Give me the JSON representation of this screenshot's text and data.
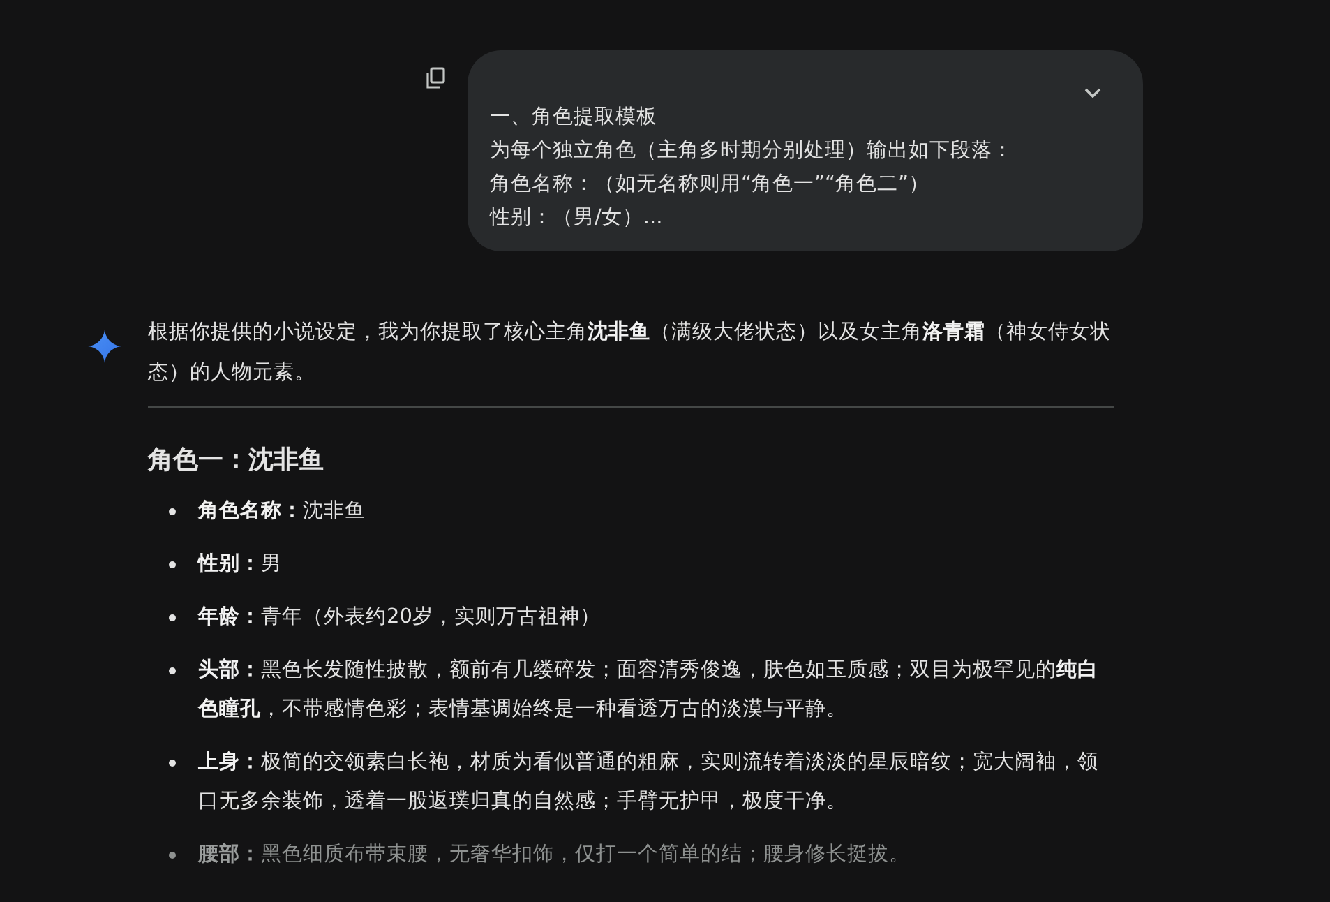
{
  "user_message": {
    "lines": [
      "一、角色提取模板",
      "为每个独立角色（主角多时期分别处理）输出如下段落：",
      "角色名称：（如无名称则用“角色一”“角色二”）",
      "性别：（男/女）..."
    ],
    "expanded": false
  },
  "response": {
    "intro": "根据你提供的小说设定，我为你提取了核心主角**沈非鱼**（满级大佬状态）以及女主角**洛青霜**（神女侍女状态）的人物元素。",
    "heading": "角色一：沈非鱼",
    "items": [
      {
        "label": "角色名称：",
        "text": "沈非鱼",
        "dimmed": false
      },
      {
        "label": "性别：",
        "text": "男",
        "dimmed": false
      },
      {
        "label": "年龄：",
        "text": "青年（外表约20岁，实则万古祖神）",
        "dimmed": false
      },
      {
        "label": "头部：",
        "text": "黑色长发随性披散，额前有几缕碎发；面容清秀俊逸，肤色如玉质感；双目为极罕见的**纯白色瞳孔**，不带感情色彩；表情基调始终是一种看透万古的淡漠与平静。",
        "dimmed": false
      },
      {
        "label": "上身：",
        "text": "极简的交领素白长袍，材质为看似普通的粗麻，实则流转着淡淡的星辰暗纹；宽大阔袖，领口无多余装饰，透着一股返璞归真的自然感；手臂无护甲，极度干净。",
        "dimmed": false
      },
      {
        "label": "腰部：",
        "text": "黑色细质布带束腰，无奢华扣饰，仅打一个简单的结；腰身修长挺拔。",
        "dimmed": true
      }
    ]
  }
}
